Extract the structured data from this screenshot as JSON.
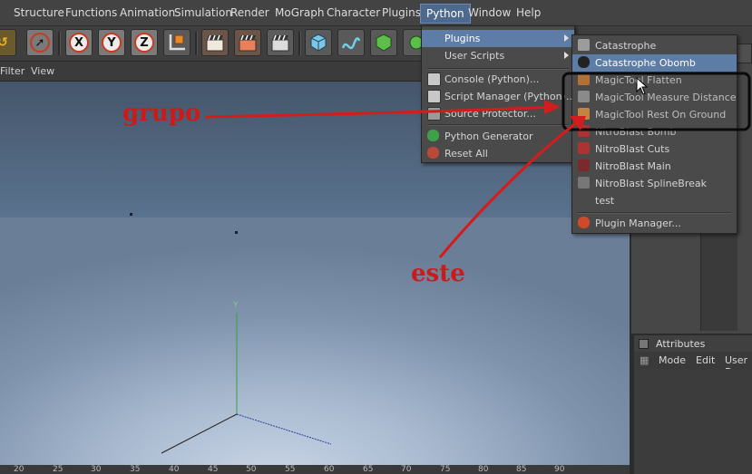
{
  "menubar": {
    "items": [
      "Structure",
      "Functions",
      "Animation",
      "Simulation",
      "Render",
      "MoGraph",
      "Character",
      "Plugins",
      "Python",
      "Window",
      "Help"
    ],
    "active": "Python"
  },
  "toolbar": {
    "axis_x": "X",
    "axis_y": "Y",
    "axis_z": "Z"
  },
  "viewport_menu": [
    "Filter",
    "View"
  ],
  "python_menu": {
    "items": [
      {
        "label": "Plugins",
        "submenu": true
      },
      {
        "label": "User Scripts",
        "submenu": true
      },
      {
        "label": "Console (Python)..."
      },
      {
        "label": "Script Manager (Python)..."
      },
      {
        "label": "Source Protector..."
      },
      {
        "label": "Python Generator"
      },
      {
        "label": "Reset All"
      }
    ]
  },
  "plugins_submenu": {
    "items": [
      {
        "label": "Catastrophe"
      },
      {
        "label": "Catastrophe Obomb"
      },
      {
        "label": "MagicTool Flatten"
      },
      {
        "label": "MagicTool Measure Distance"
      },
      {
        "label": "MagicTool Rest On Ground"
      },
      {
        "label": "NitroBlast Bomb"
      },
      {
        "label": "NitroBlast Cuts"
      },
      {
        "label": "NitroBlast Main"
      },
      {
        "label": "NitroBlast SplineBreak"
      },
      {
        "label": "test"
      },
      {
        "label": "Plugin Manager..."
      }
    ]
  },
  "attributes": {
    "title": "Attributes",
    "menu": [
      "Mode",
      "Edit",
      "User D"
    ]
  },
  "ruler_ticks": [
    "20",
    "25",
    "30",
    "35",
    "40",
    "45",
    "50",
    "55",
    "60",
    "65",
    "70",
    "75",
    "80",
    "85",
    "90"
  ],
  "annotations": {
    "grupo": "grupo",
    "este": "este"
  },
  "colors": {
    "annotation": "#cc1a1a",
    "highlight": "#5d7da6"
  },
  "viewport_axis_label": "Y"
}
